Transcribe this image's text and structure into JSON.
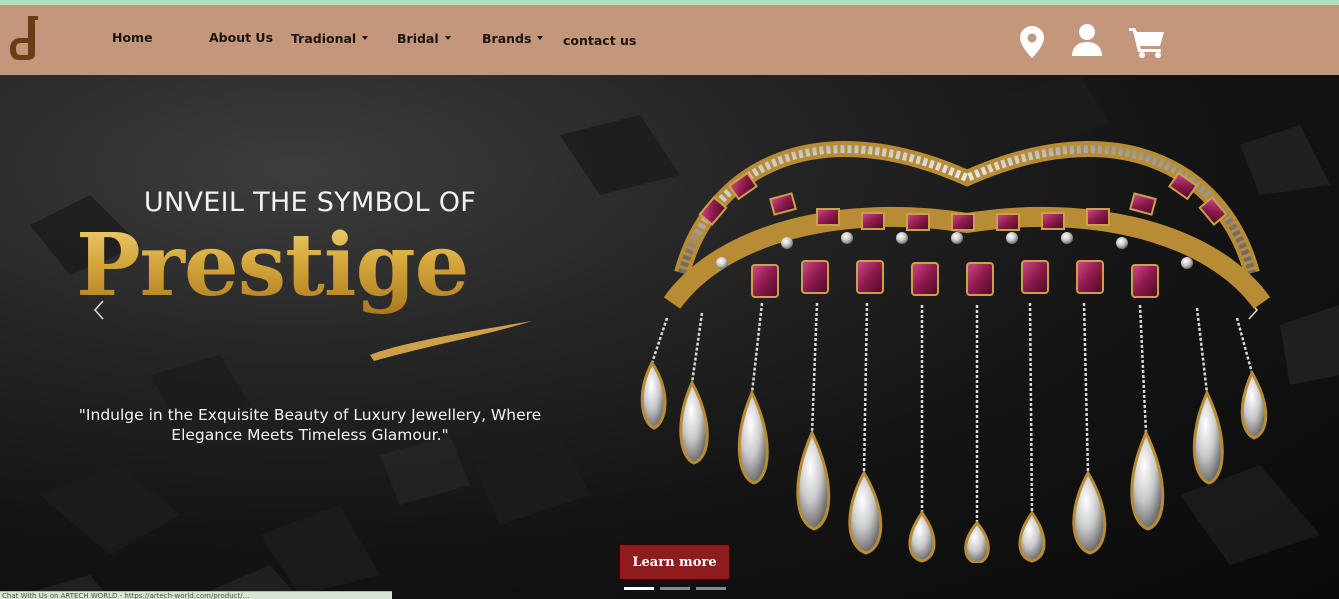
{
  "nav": {
    "items": [
      {
        "label": "Home",
        "has_dropdown": false
      },
      {
        "label": "About Us",
        "has_dropdown": false
      },
      {
        "label": "Tradional",
        "has_dropdown": true
      },
      {
        "label": "Bridal",
        "has_dropdown": true
      },
      {
        "label": "Brands",
        "has_dropdown": true
      },
      {
        "label": "contact us",
        "has_dropdown": false
      }
    ],
    "icons": [
      "map-marker-icon",
      "user-icon",
      "cart-icon"
    ],
    "background_color": "#c4977c",
    "logo_color": "#6a3d12"
  },
  "hero": {
    "eyebrow": "UNVEIL THE SYMBOL OF",
    "headline": "Prestige",
    "tagline": "\"Indulge in the Exquisite Beauty of Luxury Jewellery, Where Elegance Meets Timeless Glamour.\"",
    "cta_label": "Learn more",
    "cta_color": "#8e1c1c",
    "slide_count": 3,
    "active_slide": 1
  },
  "status_bar": {
    "text": "Chat With Us on  ARTECH WORLD - https://artech-world.com/product/..."
  }
}
